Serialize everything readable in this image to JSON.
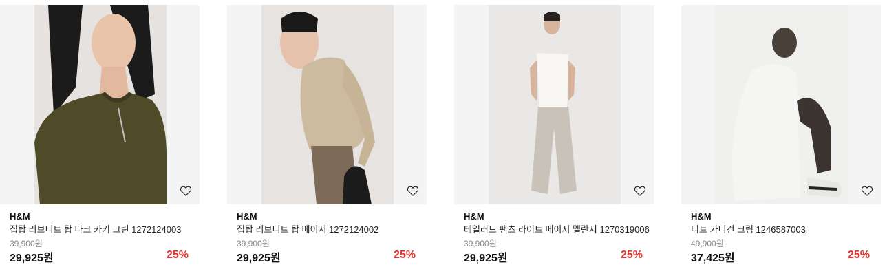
{
  "products": [
    {
      "brand": "H&M",
      "name": "집탑 리브니트 탑 다크 카키 그린 1272124003",
      "original_price": "39,900원",
      "sale_price": "29,925원",
      "discount": "25%"
    },
    {
      "brand": "H&M",
      "name": "집탑 리브니트 탑 베이지 1272124002",
      "original_price": "39,900원",
      "sale_price": "29,925원",
      "discount": "25%"
    },
    {
      "brand": "H&M",
      "name": "테일러드 팬츠 라이트 베이지 멜란지 1270319006",
      "original_price": "39,900원",
      "sale_price": "29,925원",
      "discount": "25%"
    },
    {
      "brand": "H&M",
      "name": "니트 가디건 크림 1246587003",
      "original_price": "49,900원",
      "sale_price": "37,425원",
      "discount": "25%"
    }
  ],
  "colors": {
    "discount": "#e3342f",
    "image_bg": "#f4f4f4",
    "original_price": "#888888"
  },
  "icons": {
    "wishlist": "heart-outline-icon"
  }
}
